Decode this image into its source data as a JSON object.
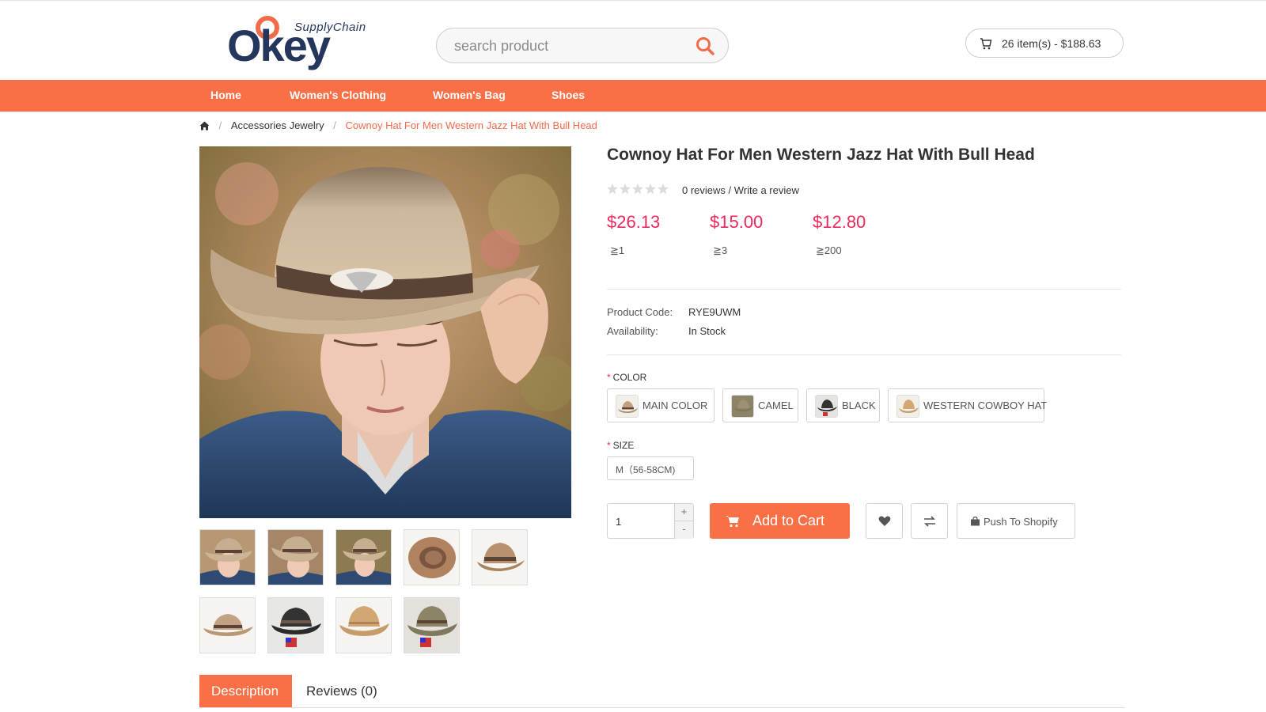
{
  "header": {
    "logo_main": "Okey",
    "logo_sub": "SupplyChain",
    "search_placeholder": "search product",
    "cart_text": "26 item(s) - $188.63"
  },
  "nav": {
    "items": [
      {
        "label": "Home"
      },
      {
        "label": "Women's Clothing"
      },
      {
        "label": "Women's Bag"
      },
      {
        "label": "Shoes"
      }
    ]
  },
  "breadcrumb": {
    "home_icon": "home-icon",
    "category": "Accessories Jewelry",
    "current": "Cownoy Hat For Men Western Jazz Hat With Bull Head"
  },
  "product": {
    "title": "Cownoy Hat For Men Western Jazz Hat With Bull Head",
    "rating": 0,
    "reviews_text": "0 reviews / Write a review",
    "prices": [
      {
        "price": "$26.13",
        "min_qty": "≧1"
      },
      {
        "price": "$15.00",
        "min_qty": "≧3"
      },
      {
        "price": "$12.80",
        "min_qty": "≧200"
      }
    ],
    "code_label": "Product Code:",
    "code_value": "RYE9UWM",
    "availability_label": "Availability:",
    "availability_value": "In Stock",
    "color_label": "COLOR",
    "colors": [
      {
        "label": "MAIN COLOR"
      },
      {
        "label": "CAMEL"
      },
      {
        "label": "BLACK"
      },
      {
        "label": "WESTERN COWBOY HAT"
      }
    ],
    "size_label": "SIZE",
    "size_value": "M（56-58CM)",
    "quantity": "1",
    "qty_plus": "+",
    "qty_minus": "-",
    "add_to_cart": "Add to Cart",
    "push_to_shopify": "Push To Shopify"
  },
  "tabs": {
    "description": "Description",
    "reviews": "Reviews (0)"
  },
  "colors": {
    "accent": "#f97047",
    "price": "#f0275a",
    "brand_navy": "#24365c"
  }
}
